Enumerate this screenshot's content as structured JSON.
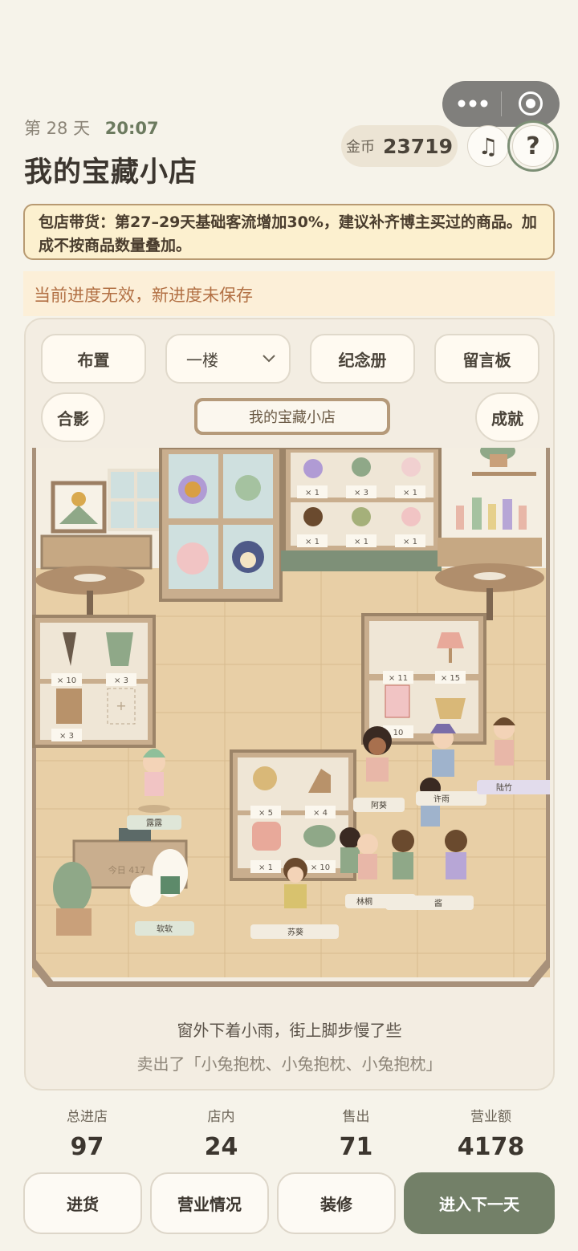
{
  "header": {
    "day_label": "第 28 天",
    "time": "20:07",
    "shop_name": "我的宝藏小店",
    "coin_label": "金币",
    "coin_value": "23719",
    "help_label": "?"
  },
  "notice": {
    "text": "包店带货：第27–29天基础客流增加30%，建议补齐博主买过的商品。加成不按商品数量叠加。"
  },
  "warning": {
    "text": "当前进度无效，新进度未保存"
  },
  "toolbar": {
    "layout_label": "布置",
    "floor_value": "一楼",
    "album_label": "纪念册",
    "board_label": "留言板",
    "photo_label": "合影",
    "achievement_label": "成就",
    "sign_text": "我的宝藏小店"
  },
  "scene": {
    "rack_counts": [
      "× 1",
      "× 3",
      "× 1",
      "× 1",
      "× 1",
      "× 1"
    ],
    "left_shelf_counts": [
      "× 10",
      "× 3",
      "× 3"
    ],
    "right_shelf_counts": [
      "× 11",
      "× 15",
      "10"
    ],
    "center_shelf_counts": [
      "× 5",
      "× 4",
      "× 1",
      "× 10"
    ],
    "register_text": "今日 417",
    "characters": [
      "露露",
      "阿葵",
      "许雨",
      "陆竹",
      "林桐",
      "酱",
      "苏葵",
      "软软"
    ],
    "character_colors": {
      "shirt_green": "#8fa888",
      "shirt_pink": "#e8b7a8",
      "shirt_blue": "#9fb3cc",
      "shirt_purple": "#b7a6d6",
      "shirt_yellow": "#d8c26e"
    }
  },
  "story": {
    "line1": "窗外下着小雨，街上脚步慢了些",
    "line2": "卖出了「小兔抱枕、小兔抱枕、小兔抱枕」"
  },
  "stats": [
    {
      "label": "总进店",
      "value": "97"
    },
    {
      "label": "店内",
      "value": "24"
    },
    {
      "label": "售出",
      "value": "71"
    },
    {
      "label": "营业额",
      "value": "4178"
    }
  ],
  "actions": {
    "restock": "进货",
    "business": "营业情况",
    "decorate": "装修",
    "next_day": "进入下一天"
  },
  "colors": {
    "accent": "#738068",
    "background": "#f6f3ea",
    "notice_bg": "#fcf0cf",
    "warning_text": "#b27044",
    "floor": "#e8cfa6",
    "wood": "#9c8468"
  }
}
